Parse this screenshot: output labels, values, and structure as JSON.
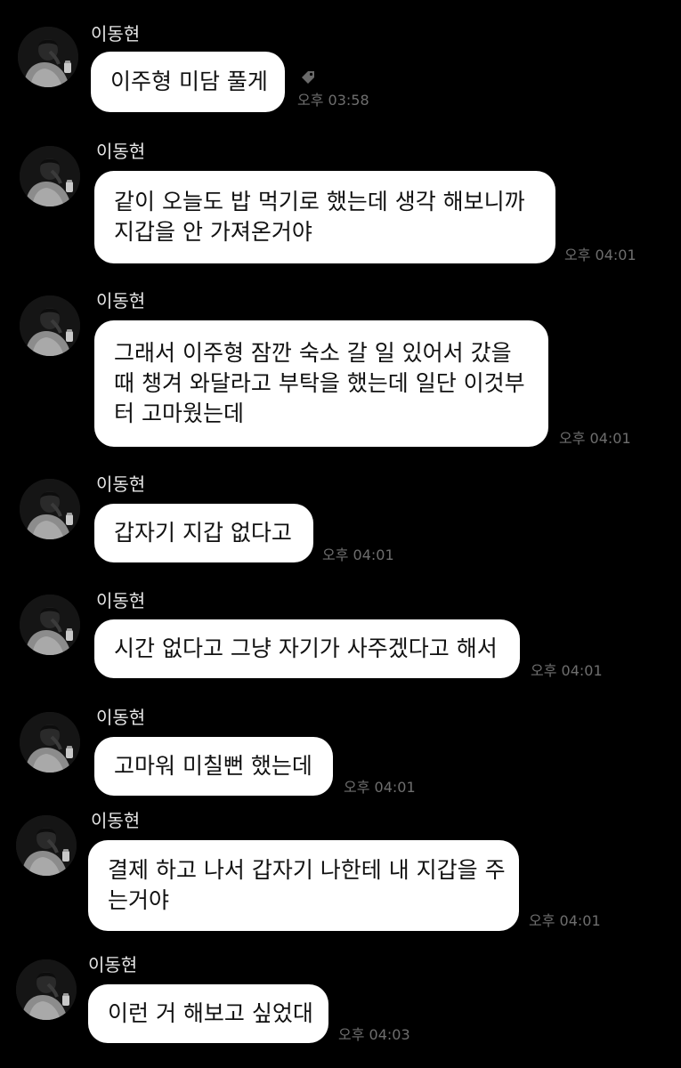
{
  "chat": {
    "messages": [
      {
        "sender": "이동현",
        "lines": [
          "이주형 미담 풀게"
        ],
        "time": "오후 03:58"
      },
      {
        "sender": "이동현",
        "lines": [
          "같이 오늘도 밥 먹기로 했는데 생각 해보니까",
          "지갑을 안 가져온거야"
        ],
        "time": "오후 04:01"
      },
      {
        "sender": "이동현",
        "lines": [
          "그래서 이주형 잠깐 숙소 갈 일 있어서 갔을",
          "때 챙겨 와달라고 부탁을 했는데 일단 이것부",
          "터 고마웠는데"
        ],
        "time": "오후 04:01"
      },
      {
        "sender": "이동현",
        "lines": [
          "갑자기 지갑 없다고"
        ],
        "time": "오후 04:01"
      },
      {
        "sender": "이동현",
        "lines": [
          "시간 없다고 그냥 자기가 사주겠다고 해서"
        ],
        "time": "오후 04:01"
      },
      {
        "sender": "이동현",
        "lines": [
          "고마워 미칠뻔 했는데"
        ],
        "time": "오후 04:01"
      },
      {
        "sender": "이동현",
        "lines": [
          "결제 하고 나서 갑자기 나한테 내 지갑을 주",
          "는거야"
        ],
        "time": "오후 04:01"
      },
      {
        "sender": "이동현",
        "lines": [
          "이런 거 해보고 싶었대"
        ],
        "time": "오후 04:03"
      }
    ],
    "icons": {
      "avatar": "profile-photo",
      "reaction": "tag-icon"
    }
  }
}
